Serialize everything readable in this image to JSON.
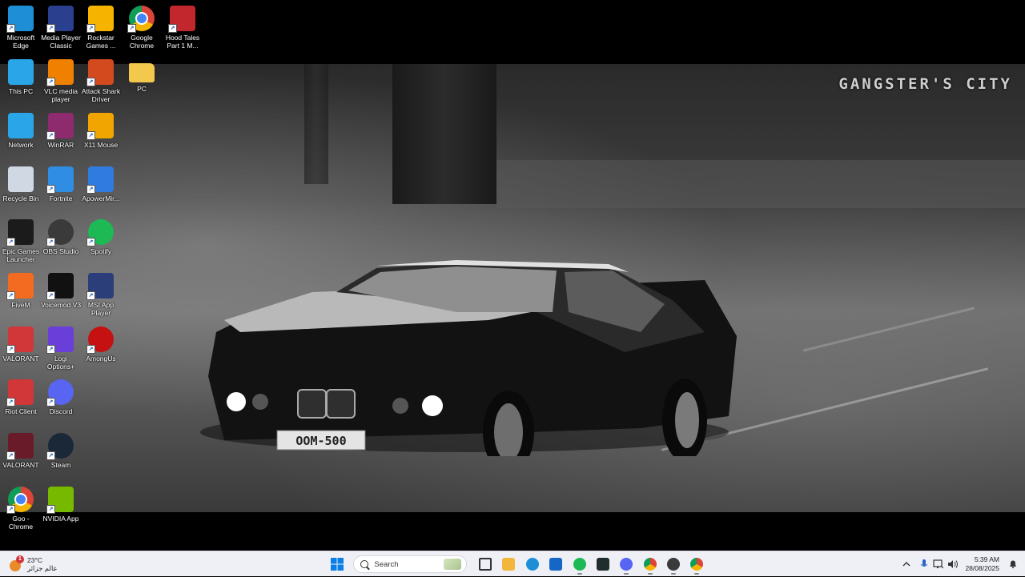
{
  "wallpaper": {
    "watermark": "GANGSTER'S CITY",
    "license_plate": "OOM-500"
  },
  "desktop_icons": [
    {
      "label": "Microsoft\nEdge",
      "icon": "edge-icon",
      "color": "#1e8fd6"
    },
    {
      "label": "Media Player\nClassic",
      "icon": "media-player-classic-icon",
      "color": "#2b3f8f"
    },
    {
      "label": "Rockstar\nGames ...",
      "icon": "rockstar-icon",
      "color": "#f6b400"
    },
    {
      "label": "Google\nChrome",
      "icon": "chrome-icon",
      "color": "#db4437"
    },
    {
      "label": "Hood Tales\nPart 1 M...",
      "icon": "moroccan-flag-icon",
      "color": "#c1272d"
    },
    {
      "label": "This PC",
      "icon": "monitor-icon",
      "color": "#2aa6e8"
    },
    {
      "label": "VLC media\nplayer",
      "icon": "vlc-cone-icon",
      "color": "#f08000"
    },
    {
      "label": "Attack Shark\nDriver",
      "icon": "shark-logo-icon",
      "color": "#d24a1e"
    },
    {
      "label": "PC",
      "icon": "folder-icon",
      "color": "#f2c94c"
    },
    {
      "label": "Network",
      "icon": "network-icon",
      "color": "#2aa6e8"
    },
    {
      "label": "WinRAR",
      "icon": "winrar-books-icon",
      "color": "#8e2b6f"
    },
    {
      "label": "X11 Mouse",
      "icon": "x11-mouse-icon",
      "color": "#f0a500"
    },
    {
      "label": "Recycle Bin",
      "icon": "recycle-bin-icon",
      "color": "#cfd8e3"
    },
    {
      "label": "Fortnite",
      "icon": "fortnite-icon",
      "color": "#2f8de4"
    },
    {
      "label": "ApowerMir...",
      "icon": "apowermirror-icon",
      "color": "#2f7be0"
    },
    {
      "label": "Epic Games\nLauncher",
      "icon": "epic-games-icon",
      "color": "#1b1b1b"
    },
    {
      "label": "OBS Studio",
      "icon": "obs-icon",
      "color": "#3a3a3a"
    },
    {
      "label": "Spotify",
      "icon": "spotify-icon",
      "color": "#1db954"
    },
    {
      "label": "FiveM",
      "icon": "fivem-icon",
      "color": "#f26b21"
    },
    {
      "label": "Voicemod V3",
      "icon": "voicemod-icon",
      "color": "#111111"
    },
    {
      "label": "MSI App\nPlayer",
      "icon": "msi-app-player-icon",
      "color": "#2c3e7a"
    },
    {
      "label": "VALORANT",
      "icon": "riot-fist-icon",
      "color": "#d13639"
    },
    {
      "label": "Logi\nOptions+",
      "icon": "logi-options-icon",
      "color": "#6a3ed8"
    },
    {
      "label": "AmongUs",
      "icon": "among-us-icon",
      "color": "#c51111"
    },
    {
      "label": "Riot Client",
      "icon": "riot-client-icon",
      "color": "#d13639"
    },
    {
      "label": "Discord",
      "icon": "discord-icon",
      "color": "#5865f2"
    },
    {
      "label": "VALORANT",
      "icon": "valorant-icon",
      "color": "#6a1b2a"
    },
    {
      "label": "Steam",
      "icon": "steam-icon",
      "color": "#1b2838"
    },
    {
      "label": "Goo -\nChrome",
      "icon": "chrome-profile-icon",
      "color": "#db4437"
    },
    {
      "label": "NVIDIA App",
      "icon": "nvidia-icon",
      "color": "#76b900"
    }
  ],
  "taskbar": {
    "weather": {
      "temp": "23°C",
      "caption": "عالم جزائر",
      "badge": "1"
    },
    "search_placeholder": "Search",
    "apps": [
      {
        "name": "start-button",
        "icon": "windows-logo-icon",
        "color": "#0a7fe6",
        "active": false
      },
      {
        "name": "task-view-button",
        "icon": "task-view-icon",
        "color": "#333333",
        "active": false
      },
      {
        "name": "file-explorer-button",
        "icon": "folder-icon",
        "color": "#f2b63c",
        "active": false
      },
      {
        "name": "edge-taskbar-button",
        "icon": "edge-icon",
        "color": "#1e8fd6",
        "active": false
      },
      {
        "name": "store-taskbar-button",
        "icon": "store-icon",
        "color": "#1666c5",
        "active": false
      },
      {
        "name": "spotify-taskbar-button",
        "icon": "spotify-icon",
        "color": "#1db954",
        "active": true
      },
      {
        "name": "terminal-taskbar-button",
        "icon": "terminal-icon",
        "color": "#1f2d2d",
        "active": false
      },
      {
        "name": "discord-taskbar-button",
        "icon": "discord-icon",
        "color": "#5865f2",
        "active": true
      },
      {
        "name": "chrome-taskbar-button",
        "icon": "chrome-icon",
        "color": "#db4437",
        "active": true
      },
      {
        "name": "obs-taskbar-button",
        "icon": "obs-icon",
        "color": "#3a3a3a",
        "active": true
      },
      {
        "name": "chrome-profile-taskbar-button",
        "icon": "chrome-profile-icon",
        "color": "#db4437",
        "active": true
      }
    ],
    "tray": {
      "time": "5:39 AM",
      "date": "28/08/2025"
    }
  }
}
